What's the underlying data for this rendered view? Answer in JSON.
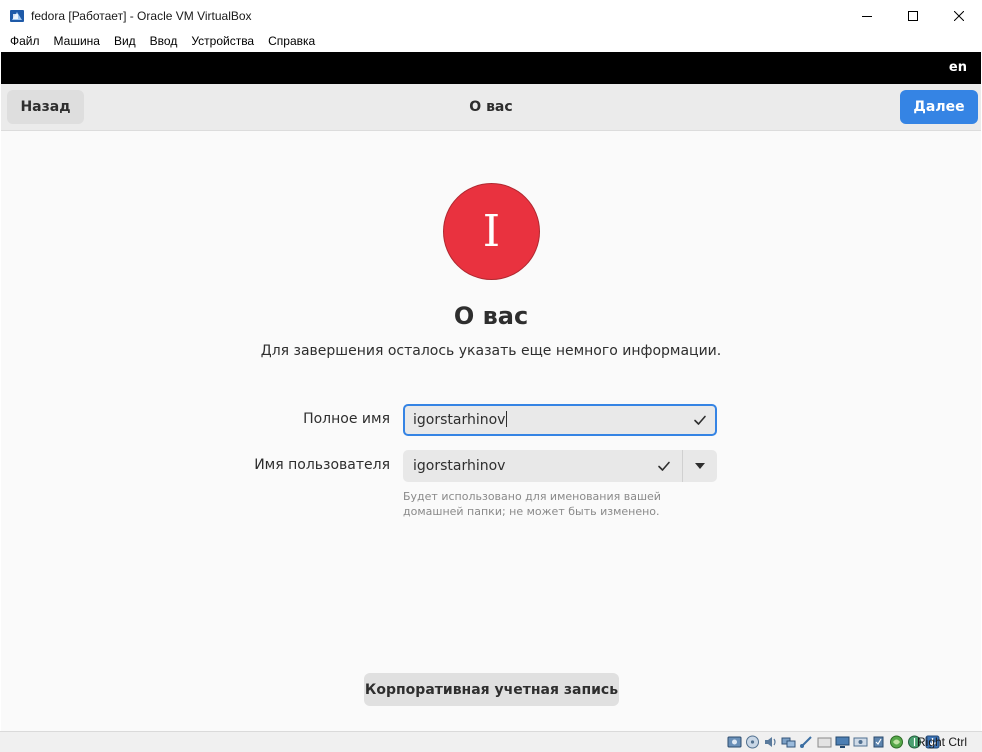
{
  "window": {
    "title": "fedora [Работает] - Oracle VM VirtualBox",
    "icon": "virtualbox-app-icon",
    "controls": [
      "minimize-icon",
      "maximize-icon",
      "close-icon"
    ]
  },
  "menubar": {
    "items": [
      "Файл",
      "Машина",
      "Вид",
      "Ввод",
      "Устройства",
      "Справка"
    ]
  },
  "guest": {
    "topbar": {
      "language": "en"
    },
    "header": {
      "back_label": "Назад",
      "title": "О вас",
      "next_label": "Далее"
    },
    "avatar_initial": "I",
    "heading": "О вас",
    "subtitle": "Для завершения осталось указать еще немного информации.",
    "form": {
      "full_name": {
        "label": "Полное имя",
        "value": "igorstarhinov"
      },
      "username": {
        "label": "Имя пользователя",
        "value": "igorstarhinov"
      },
      "hint": "Будет использовано для именования вашей домашней папки; не может быть изменено."
    },
    "enterprise_button": "Корпоративная учетная запись"
  },
  "statusbar": {
    "icons": [
      "hard-disk-icon",
      "optical-drive-icon",
      "audio-icon",
      "network-icon",
      "usb-icon",
      "shared-folders-icon",
      "display-icon",
      "video-capture-icon",
      "cpu-icon",
      "guest-additions-icon",
      "mouse-integration-icon",
      "keyboard-capture-icon"
    ],
    "host_key": "Right Ctrl"
  },
  "colors": {
    "accent": "#3584e4",
    "avatar": "#e9323f",
    "header_bg": "#ebebeb",
    "topbar_bg": "#000000"
  }
}
